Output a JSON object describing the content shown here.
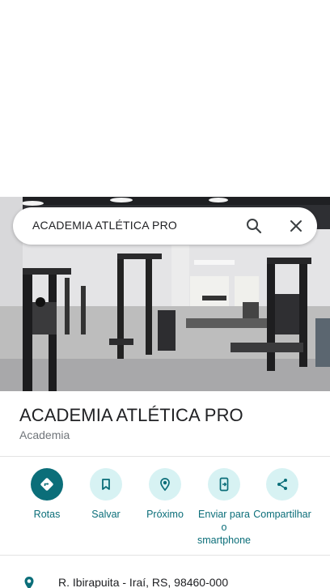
{
  "search": {
    "query": "ACADEMIA ATLÉTICA PRO"
  },
  "place": {
    "name": "ACADEMIA ATLÉTICA PRO",
    "category": "Academia",
    "address": "R. Ibirapuita - Iraí, RS, 98460-000"
  },
  "actions": [
    {
      "label": "Rotas",
      "icon": "directions-icon"
    },
    {
      "label": "Salvar",
      "icon": "bookmark-icon"
    },
    {
      "label": "Próximo",
      "icon": "nearby-icon"
    },
    {
      "label": "Enviar para o smartphone",
      "icon": "send-to-phone-icon"
    },
    {
      "label": "Compartilhar",
      "icon": "share-icon"
    }
  ],
  "colors": {
    "accent": "#0b6e79",
    "accent_light": "#d7f2f3",
    "text_primary": "#202124",
    "text_secondary": "#70757a"
  }
}
